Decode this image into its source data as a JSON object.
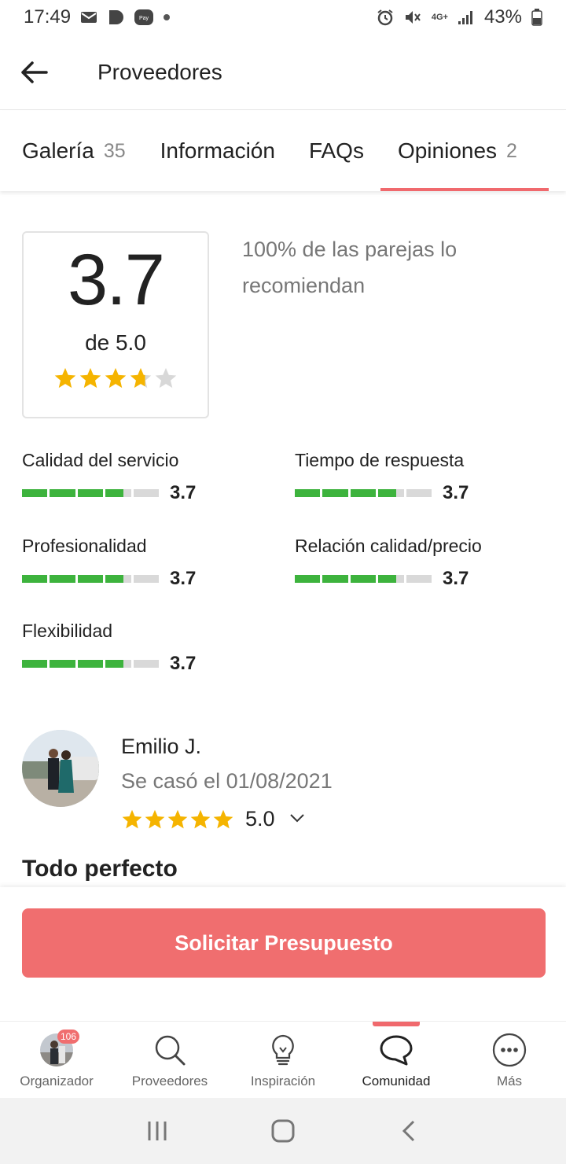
{
  "status_bar": {
    "time": "17:49",
    "network": "4G+",
    "battery": "43%"
  },
  "header": {
    "title": "Proveedores"
  },
  "tabs": [
    {
      "label": "Galería",
      "count": "35"
    },
    {
      "label": "Información",
      "count": ""
    },
    {
      "label": "FAQs",
      "count": ""
    },
    {
      "label": "Opiniones",
      "count": "2"
    }
  ],
  "active_tab": "Opiniones",
  "rating": {
    "score": "3.7",
    "out_of": "de 5.0",
    "stars_value": 3.7,
    "recommend_text": "100% de las parejas lo recomiendan"
  },
  "criteria": [
    {
      "label": "Calidad del servicio",
      "value": "3.7",
      "fraction": 0.74
    },
    {
      "label": "Tiempo de respuesta",
      "value": "3.7",
      "fraction": 0.74
    },
    {
      "label": "Profesionalidad",
      "value": "3.7",
      "fraction": 0.74
    },
    {
      "label": "Relación calidad/precio",
      "value": "3.7",
      "fraction": 0.74
    },
    {
      "label": "Flexibilidad",
      "value": "3.7",
      "fraction": 0.74
    }
  ],
  "review": {
    "name": "Emilio J.",
    "date": "Se casó el 01/08/2021",
    "score": "5.0",
    "stars_value": 5,
    "title": "Todo perfecto"
  },
  "cta": {
    "label": "Solicitar Presupuesto"
  },
  "bottom_nav": {
    "items": [
      {
        "label": "Organizador",
        "icon": "avatar-icon"
      },
      {
        "label": "Proveedores",
        "icon": "search-icon"
      },
      {
        "label": "Inspiración",
        "icon": "lightbulb-icon"
      },
      {
        "label": "Comunidad",
        "icon": "chat-bubble-icon"
      },
      {
        "label": "Más",
        "icon": "more-icon"
      }
    ],
    "active": "Comunidad",
    "badge": "106"
  },
  "colors": {
    "accent": "#f0696d",
    "bar_fill": "#3db33d",
    "bar_empty": "#d9d9d9",
    "star": "#f5b400"
  }
}
